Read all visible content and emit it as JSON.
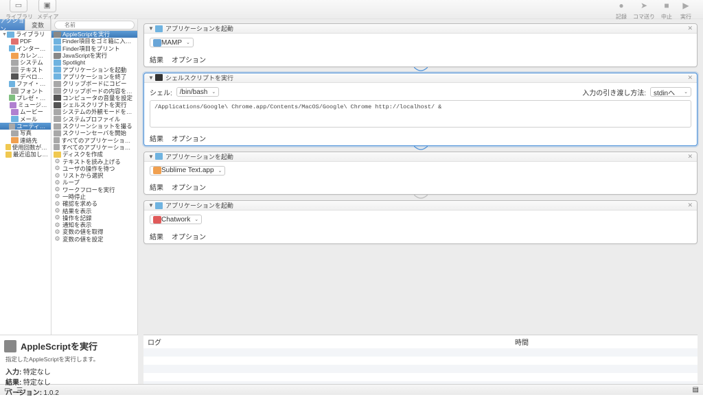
{
  "toolbar": {
    "left": [
      {
        "icon": "▭",
        "label": "ライブラリ"
      },
      {
        "icon": "▣",
        "label": "メディア"
      }
    ],
    "right": [
      {
        "icon": "●",
        "label": "記録"
      },
      {
        "icon": "➤",
        "label": "コマ送り"
      },
      {
        "icon": "■",
        "label": "中止"
      },
      {
        "icon": "▶",
        "label": "実行"
      }
    ]
  },
  "side_tabs": {
    "actions": "アクション",
    "vars": "変数"
  },
  "search_placeholder": "名前",
  "categories": [
    {
      "label": "ライブラリ",
      "cls": "folder",
      "tri": "▼"
    },
    {
      "label": "PDF",
      "cls": "red",
      "indent": 1
    },
    {
      "label": "インターネット",
      "cls": "folder",
      "indent": 1
    },
    {
      "label": "カレンダー",
      "cls": "orange",
      "indent": 1
    },
    {
      "label": "システム",
      "cls": "gray",
      "indent": 1
    },
    {
      "label": "テキスト",
      "cls": "gray",
      "indent": 1
    },
    {
      "label": "デベロッパ",
      "cls": "dark",
      "indent": 1
    },
    {
      "label": "ファイ・ォルダ",
      "cls": "folder",
      "indent": 1
    },
    {
      "label": "フォント",
      "cls": "gray",
      "indent": 1
    },
    {
      "label": "プレゼ・ション",
      "cls": "green",
      "indent": 1
    },
    {
      "label": "ミュージック",
      "cls": "purple",
      "indent": 1
    },
    {
      "label": "ムービー",
      "cls": "purple",
      "indent": 1
    },
    {
      "label": "メール",
      "cls": "folder",
      "indent": 1
    },
    {
      "label": "ユーティリティ",
      "cls": "gray",
      "indent": 1,
      "sel": true
    },
    {
      "label": "写真",
      "cls": "gray",
      "indent": 1
    },
    {
      "label": "連絡先",
      "cls": "orange",
      "indent": 1
    },
    {
      "label": "使用回数が多いもの",
      "cls": "yellow"
    },
    {
      "label": "最近追加したもの",
      "cls": "yellow"
    }
  ],
  "actions_list": [
    {
      "label": "AppleScriptを実行",
      "cls": "script",
      "sel": true
    },
    {
      "label": "Finder項目をゴミ箱に入れる",
      "cls": "folder"
    },
    {
      "label": "Finder項目をプリント",
      "cls": "folder"
    },
    {
      "label": "JavaScriptを実行",
      "cls": "script"
    },
    {
      "label": "Spotlight",
      "cls": "folder"
    },
    {
      "label": "アプリケーションを起動",
      "cls": "folder"
    },
    {
      "label": "アプリケーションを終了",
      "cls": "folder"
    },
    {
      "label": "クリップボードにコピー",
      "cls": "gray"
    },
    {
      "label": "クリップボードの内容を取得",
      "cls": "gray"
    },
    {
      "label": "コンピュータの音量を設定",
      "cls": "dark"
    },
    {
      "label": "シェルスクリプトを実行",
      "cls": "dark"
    },
    {
      "label": "システムの外観モードを変更",
      "cls": "gray"
    },
    {
      "label": "システムプロファイル",
      "cls": "gray"
    },
    {
      "label": "スクリーンショットを撮る",
      "cls": "gray"
    },
    {
      "label": "スクリーンセーバを開始",
      "cls": "gray"
    },
    {
      "label": "すべてのアプリケーションを隠す",
      "cls": "gray"
    },
    {
      "label": "すべてのアプリケーションを終了",
      "cls": "gray"
    },
    {
      "label": "ディスクを作成",
      "cls": "yellow"
    },
    {
      "label": "テキストを読み上げる",
      "cls": "cog"
    },
    {
      "label": "ユーザの操作を待つ",
      "cls": "cog"
    },
    {
      "label": "リストから選択",
      "cls": "cog"
    },
    {
      "label": "ループ",
      "cls": "cog"
    },
    {
      "label": "ワークフローを実行",
      "cls": "cog"
    },
    {
      "label": "一時停止",
      "cls": "cog"
    },
    {
      "label": "確認を求める",
      "cls": "cog"
    },
    {
      "label": "結果を表示",
      "cls": "cog"
    },
    {
      "label": "操作を記録",
      "cls": "cog"
    },
    {
      "label": "通知を表示",
      "cls": "cog"
    },
    {
      "label": "変数の値を取得",
      "cls": "cog"
    },
    {
      "label": "変数の値を設定",
      "cls": "cog"
    }
  ],
  "workflow": {
    "footer": {
      "results": "結果",
      "options": "オプション"
    },
    "launch_title": "アプリケーションを起動",
    "shell_title": "シェルスクリプトを実行",
    "actions": [
      {
        "app": "MAMP",
        "color": "#6aa6d8"
      },
      {
        "app": "Sublime Text.app",
        "color": "#f0a050"
      },
      {
        "app": "Chatwork",
        "color": "#e05a5a"
      }
    ],
    "shell": {
      "shell_label": "シェル:",
      "shell_value": "/bin/bash",
      "pass_label": "入力の引き渡し方法:",
      "pass_value": "stdinへ",
      "code": "/Applications/Google\\ Chrome.app/Contents/MacOS/Google\\ Chrome http://localhost/ &"
    }
  },
  "log": {
    "col1": "ログ",
    "col2": "時間"
  },
  "info": {
    "title": "AppleScriptを実行",
    "desc": "指定したAppleScriptを実行します。",
    "k1": "入力:",
    "v1": "特定なし",
    "k2": "結果:",
    "v2": "特定なし",
    "k3": "バージョン:",
    "v3": "1.0.2"
  }
}
